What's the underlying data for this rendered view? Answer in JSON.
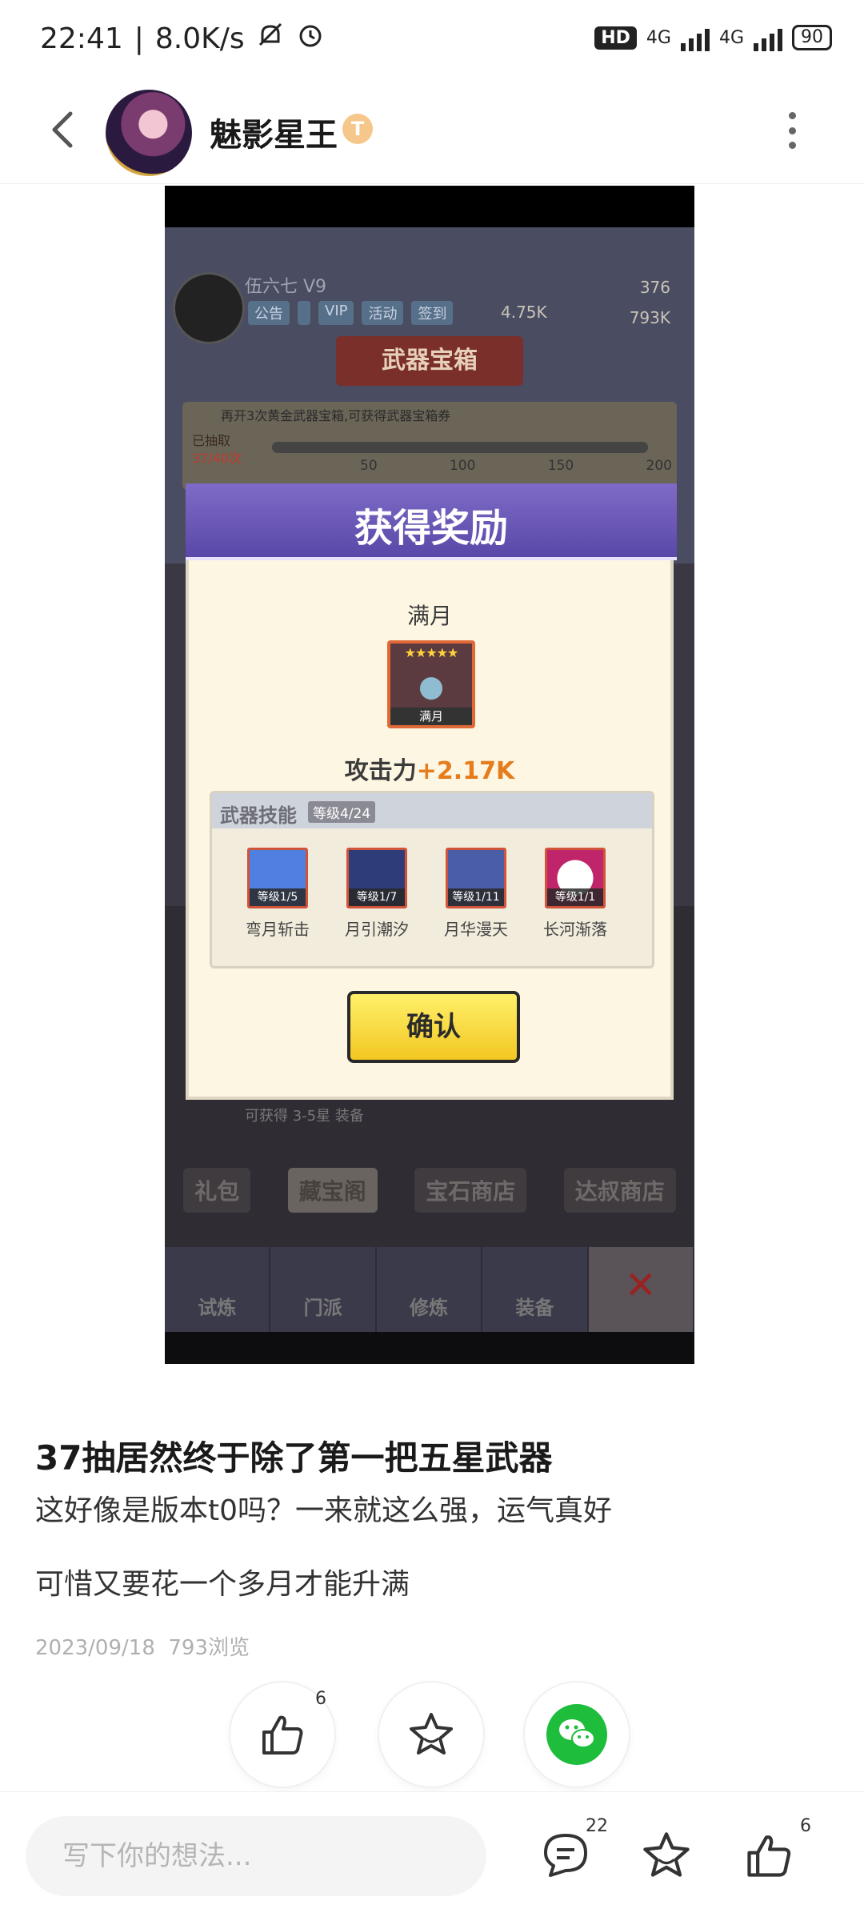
{
  "status_bar": {
    "time": "22:41",
    "separator": "|",
    "net_speed": "8.0K/s",
    "hd_label": "HD",
    "net1": "4G",
    "net2": "4G",
    "battery": "90"
  },
  "header": {
    "author": "魅影星王",
    "badge": "T"
  },
  "game": {
    "player_name": "伍六七 V9",
    "chips": [
      "公告",
      "",
      "VIP",
      "活动",
      "签到"
    ],
    "res_gems": "376",
    "res_gold": "793K",
    "res_coins": "4.75K",
    "chest_banner": "武器宝箱",
    "progress_note": "再开3次黄金武器宝箱,可获得武器宝箱券",
    "progress_label": "已抽取",
    "progress_count": "37/40次",
    "milestones": [
      "50",
      "100",
      "150",
      "200"
    ],
    "hint": "可获得 3-5星 装备",
    "tabs": [
      "礼包",
      "藏宝阁",
      "宝石商店",
      "达叔商店"
    ],
    "nav": [
      "试炼",
      "门派",
      "修炼",
      "装备",
      "✕"
    ],
    "modal": {
      "title": "获得奖励",
      "item_name": "满月",
      "item_stars": "★★★★★",
      "item_caption": "满月",
      "atk_label": "攻击力",
      "atk_value": "+2.17K",
      "skills_title": "武器技能",
      "skills_level": "等级4/24",
      "skills": [
        {
          "level": "等级1/5",
          "name": "弯月斩击",
          "color": "#4f7fe0"
        },
        {
          "level": "等级1/7",
          "name": "月引潮汐",
          "color": "#2e3d7a"
        },
        {
          "level": "等级1/11",
          "name": "月华漫天",
          "color": "#4a5ea8"
        },
        {
          "level": "等级1/1",
          "name": "长河渐落",
          "color": "#c0246a"
        }
      ],
      "confirm": "确认"
    }
  },
  "post": {
    "title": "37抽居然终于除了第一把五星武器",
    "line1": "这好像是版本t0吗？一来就这么强，运气真好",
    "line2": "可惜又要花一个多月才能升满",
    "date": "2023/09/18",
    "views": "793浏览"
  },
  "actions": {
    "like_count": "6"
  },
  "bottom": {
    "placeholder": "写下你的想法...",
    "comment_count": "22",
    "like_count": "6"
  },
  "colors": {
    "wechat": "#1fbd3c",
    "modal_header": "#6a58b8",
    "confirm_btn": "#f7dc3a",
    "atk_value": "#e57d1c"
  }
}
